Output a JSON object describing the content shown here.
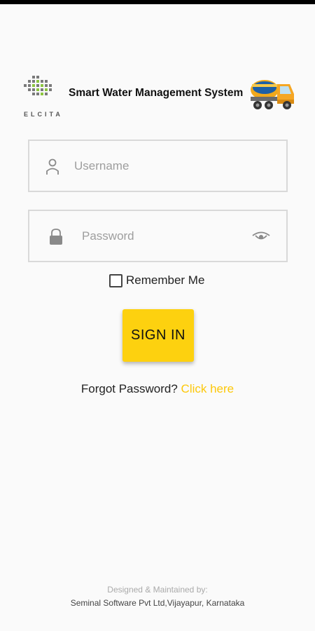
{
  "header": {
    "logo_text": "ELCITA",
    "title": "Smart Water Management System"
  },
  "form": {
    "username_placeholder": "Username",
    "password_placeholder": "Password",
    "remember_label": "Remember Me",
    "signin_label": "SIGN IN",
    "forgot_text": "Forgot Password?",
    "forgot_link": "Click here"
  },
  "footer": {
    "line1": "Designed & Maintained by:",
    "line2": "Seminal Software Pvt Ltd,Vijayapur, Karnataka"
  },
  "icons": {
    "username": "person-icon",
    "password": "lock-icon",
    "visibility": "eye-icon",
    "brand": "truck-icon"
  },
  "colors": {
    "accent": "#fdd10f",
    "link": "#fdc80a",
    "field_border": "#d9d9d9",
    "background": "#fafafa"
  }
}
